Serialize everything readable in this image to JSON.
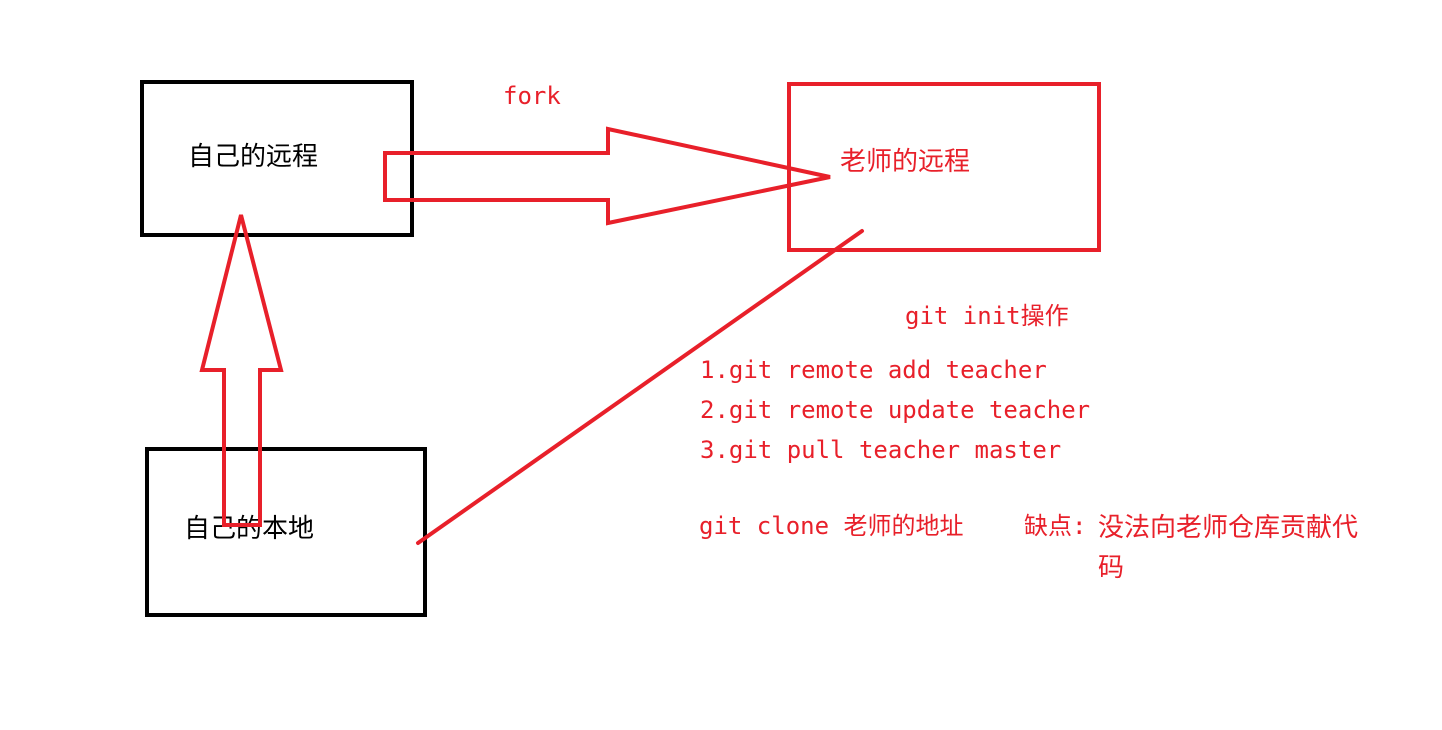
{
  "colors": {
    "red": "#e8202a",
    "black": "#000000",
    "background": "#ffffff"
  },
  "boxes": {
    "own_remote": "自己的远程",
    "teacher_remote": "老师的远程",
    "own_local": "自己的本地"
  },
  "fork_label": "fork",
  "notes": {
    "heading": "git init操作",
    "steps": [
      "1.git remote add teacher",
      "2.git remote update teacher",
      "3.git pull teacher master"
    ],
    "clone_line": "git clone 老师的地址",
    "drawback_label": "缺点:",
    "drawback_line1": "没法向老师仓库贡献代",
    "drawback_line2": "码"
  }
}
